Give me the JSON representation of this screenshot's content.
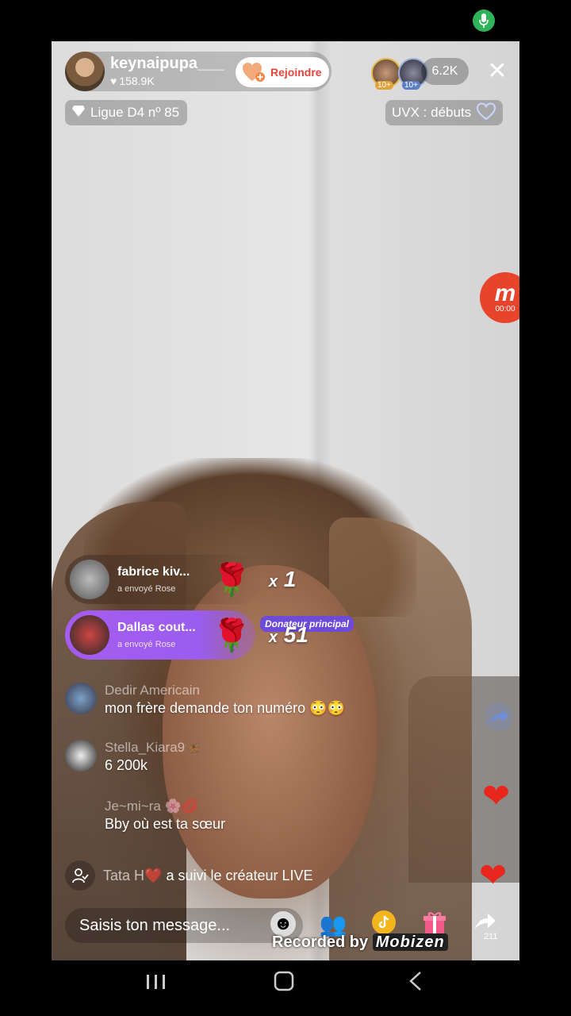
{
  "status_bar": {
    "mic_icon": "microphone-icon"
  },
  "host": {
    "name": "keynaipupa___",
    "likes": "158.9K",
    "join_label": "Rejoindre"
  },
  "viewers": {
    "avatar_rank_1": "10+",
    "avatar_rank_2": "10+",
    "count": "6.2K"
  },
  "league": {
    "label": "Ligue D4 nº 85"
  },
  "uvx": {
    "label": "UVX : débuts"
  },
  "recorder": {
    "badge": "m",
    "time": "00:00"
  },
  "gifts": [
    {
      "user": "fabrice kiv...",
      "sent": "a envoyé  Rose",
      "mult_prefix": "x",
      "count": "1"
    },
    {
      "user": "Dallas cout...",
      "sent": "a envoyé  Rose",
      "mult_prefix": "x",
      "count": "51",
      "badge": "Donateur principal"
    }
  ],
  "chat": [
    {
      "user": "Dedir Americain",
      "message": "mon frère demande ton numéro 😳😳"
    },
    {
      "user": "Stella_Kiara9🦋",
      "message": "6 200k"
    },
    {
      "user": "Je~mi~ra 🌸💋",
      "message": "Bby où est ta sœur"
    }
  ],
  "follow": {
    "user": "Tata H❤️",
    "text": "a suivi le créateur LIVE"
  },
  "input": {
    "placeholder": "Saisis ton message..."
  },
  "share_count": "211",
  "recording": {
    "label": "Recorded by",
    "brand": "Mobizen"
  },
  "colors": {
    "live_red": "#e8261e",
    "join_text": "#e8443a",
    "donor_badge": "#6b4bd8",
    "gift_highlight": "#9b5cf0"
  }
}
